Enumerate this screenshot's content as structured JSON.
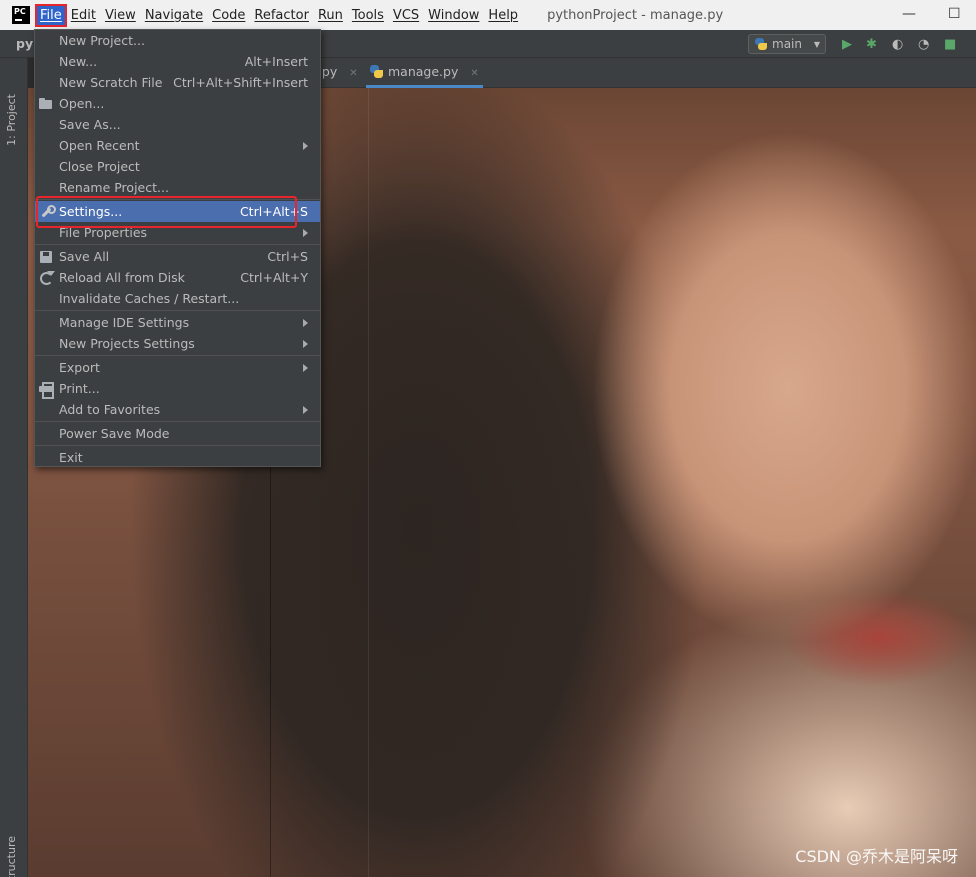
{
  "menubar": {
    "logo": "PC",
    "items": [
      "File",
      "Edit",
      "View",
      "Navigate",
      "Code",
      "Refactor",
      "Run",
      "Tools",
      "VCS",
      "Window",
      "Help"
    ],
    "active_item": "File",
    "window_title": "pythonProject - manage.py",
    "minimize_glyph": "—",
    "maximize_glyph": "☐"
  },
  "ide": {
    "project_crumb": "py",
    "run_config": "main",
    "tabs": [
      {
        "label": "n.py"
      },
      {
        "label": "manage.py",
        "active": true
      }
    ],
    "side_tabs": {
      "project": "1: Project",
      "structure": "Z: Structure"
    }
  },
  "file_menu": {
    "items": [
      {
        "label": "New Project..."
      },
      {
        "label": "New...",
        "shortcut": "Alt+Insert"
      },
      {
        "label": "New Scratch File",
        "shortcut": "Ctrl+Alt+Shift+Insert"
      },
      {
        "label": "Open...",
        "icon": "folder-icon"
      },
      {
        "label": "Save As..."
      },
      {
        "label": "Open Recent",
        "submenu": true
      },
      {
        "label": "Close Project"
      },
      {
        "label": "Rename Project..."
      },
      {
        "separator": true
      },
      {
        "label": "Settings...",
        "shortcut": "Ctrl+Alt+S",
        "icon": "wrench-icon",
        "highlighted": true
      },
      {
        "label": "File Properties",
        "submenu": true
      },
      {
        "separator": true
      },
      {
        "label": "Save All",
        "shortcut": "Ctrl+S",
        "icon": "save-icon"
      },
      {
        "label": "Reload All from Disk",
        "shortcut": "Ctrl+Alt+Y",
        "icon": "reload-icon"
      },
      {
        "label": "Invalidate Caches / Restart..."
      },
      {
        "separator": true
      },
      {
        "label": "Manage IDE Settings",
        "submenu": true
      },
      {
        "label": "New Projects Settings",
        "submenu": true
      },
      {
        "separator": true
      },
      {
        "label": "Export",
        "submenu": true
      },
      {
        "label": "Print...",
        "icon": "print-icon"
      },
      {
        "label": "Add to Favorites",
        "submenu": true
      },
      {
        "separator": true
      },
      {
        "label": "Power Save Mode"
      },
      {
        "separator": true
      },
      {
        "label": "Exit"
      }
    ]
  },
  "watermark": "CSDN @乔木是阿呆呀",
  "colors": {
    "menu_bg": "#3c3f41",
    "highlight": "#4b6eaf",
    "annotation_red": "#e8252b",
    "menubar_bg": "#f0f0f0"
  }
}
